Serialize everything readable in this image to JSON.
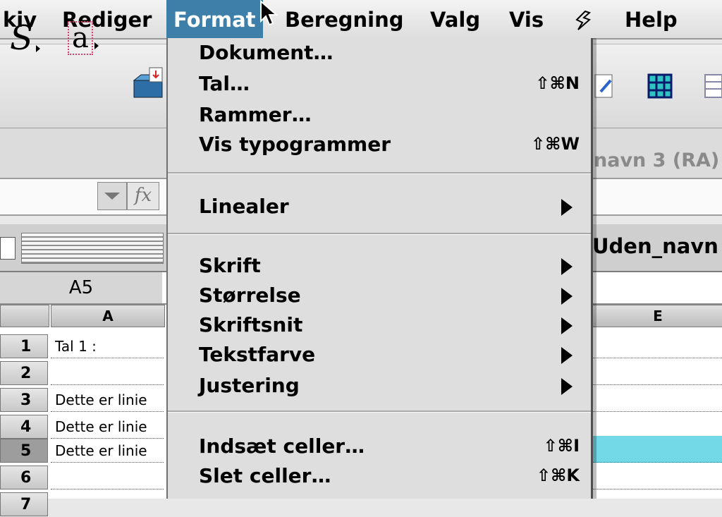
{
  "menubar": {
    "items": [
      "kiv",
      "Rediger",
      "Format",
      "Beregning",
      "Valg",
      "Vis",
      "Help"
    ],
    "active": "Format",
    "script_icon": "script-menu-icon"
  },
  "toolbar": {
    "style_glyph": "S",
    "textbox_glyph": "a"
  },
  "document": {
    "title_fragment": "navn 3 (RA)",
    "sheet_tab": "Uden_navn",
    "cell_reference": "A5",
    "fx_label": "fx"
  },
  "grid": {
    "columns": [
      "A",
      "E"
    ],
    "rows": [
      {
        "num": "1",
        "a": "Tal 1 :"
      },
      {
        "num": "2",
        "a": ""
      },
      {
        "num": "3",
        "a": "Dette er linie"
      },
      {
        "num": "4",
        "a": "Dette er linie"
      },
      {
        "num": "5",
        "a": "Dette er linie"
      },
      {
        "num": "6",
        "a": ""
      },
      {
        "num": "7",
        "a": ""
      }
    ],
    "selected_row": "5",
    "selection_color": "#74d9e6"
  },
  "menu": {
    "items": [
      {
        "label": "Dokument…",
        "shortcut": ""
      },
      {
        "label": "Tal…",
        "shortcut": "⇧⌘N"
      },
      {
        "label": "Rammer…",
        "shortcut": ""
      },
      {
        "label": "Vis typogrammer",
        "shortcut": "⇧⌘W"
      },
      {
        "label": "Linealer",
        "submenu": true
      },
      {
        "label": "Skrift",
        "submenu": true
      },
      {
        "label": "Størrelse",
        "submenu": true
      },
      {
        "label": "Skriftsnit",
        "submenu": true
      },
      {
        "label": "Tekstfarve",
        "submenu": true
      },
      {
        "label": "Justering",
        "submenu": true
      },
      {
        "label": "Indsæt celler…",
        "shortcut": "⇧⌘I"
      },
      {
        "label": "Slet celler…",
        "shortcut": "⇧⌘K"
      }
    ]
  },
  "colors": {
    "menu_highlight": "#3d7fa8",
    "menu_background": "#dedede"
  }
}
